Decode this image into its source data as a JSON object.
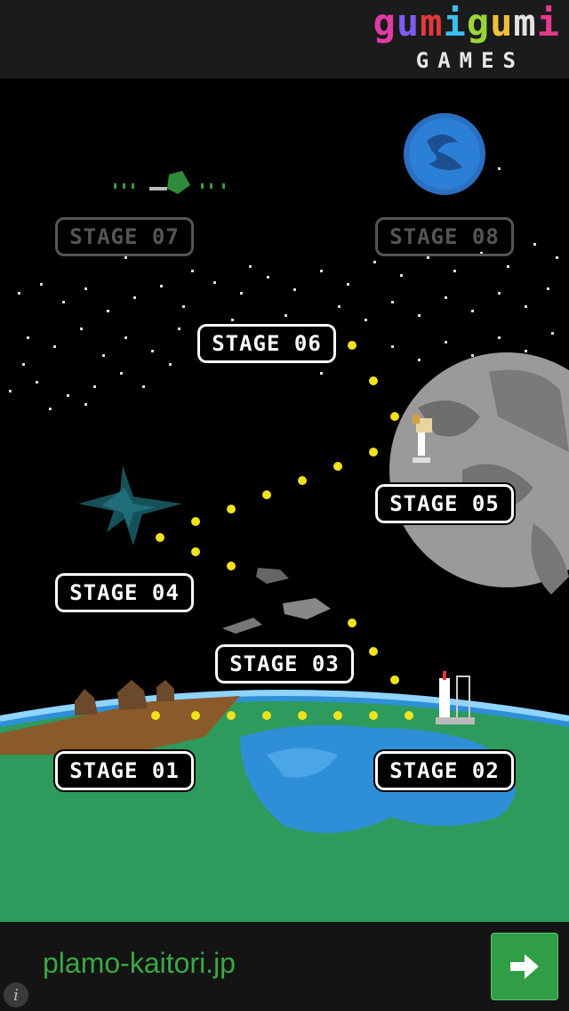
{
  "brand": {
    "logo_letters": [
      "g",
      "u",
      "m",
      "i",
      "g",
      "u",
      "m",
      "i"
    ],
    "logo_colors": [
      "#e23aa4",
      "#7d5cf0",
      "#e23a3a",
      "#3ac0f0",
      "#9bd43a",
      "#f0c03a",
      "#e2e2e2",
      "#e23a90"
    ],
    "subtitle": "GAMES"
  },
  "stages": [
    {
      "label": "STAGE 01",
      "locked": false
    },
    {
      "label": "STAGE 02",
      "locked": false
    },
    {
      "label": "STAGE 03",
      "locked": false
    },
    {
      "label": "STAGE 04",
      "locked": false
    },
    {
      "label": "STAGE 05",
      "locked": false
    },
    {
      "label": "STAGE 06",
      "locked": false
    },
    {
      "label": "STAGE 07",
      "locked": true
    },
    {
      "label": "STAGE 08",
      "locked": true
    }
  ],
  "ad": {
    "text": "plamo-kaitori.jp",
    "button_icon": "arrow-right-icon",
    "info_icon": "info-icon",
    "info_glyph": "i"
  },
  "colors": {
    "accent_green": "#2f9e44",
    "path_dot": "#f2e21a",
    "earth_ground": "#2e9a5c",
    "earth_water": "#2f8fd6",
    "moon": "#9a9a9a"
  }
}
